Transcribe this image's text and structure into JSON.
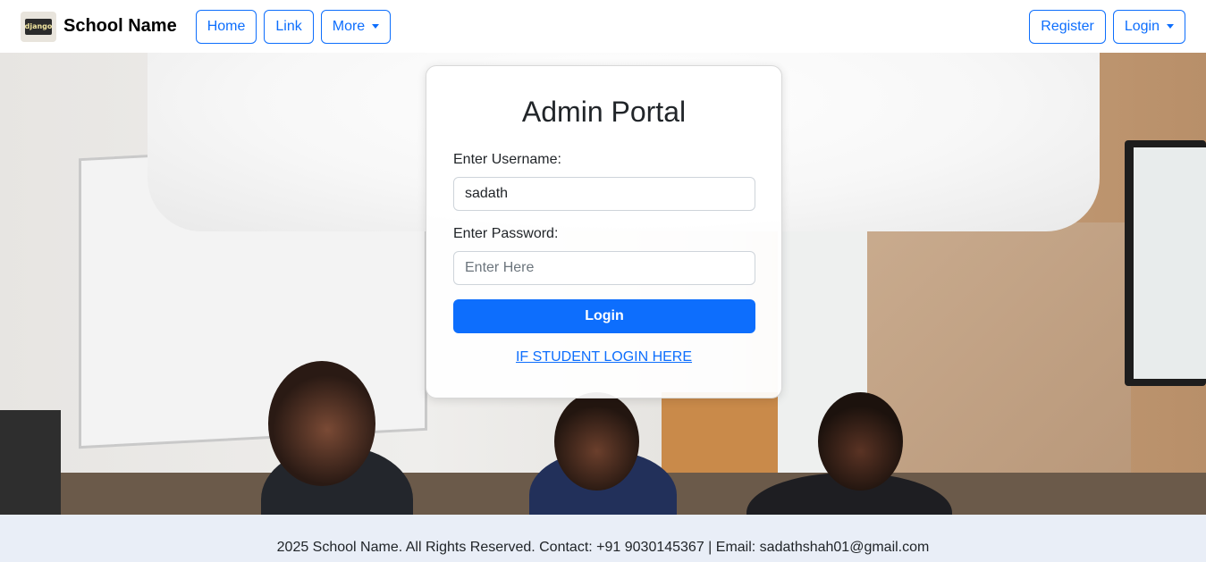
{
  "brand": {
    "name": "School Name",
    "logo_text": "django"
  },
  "nav": {
    "home": "Home",
    "link": "Link",
    "more": "More",
    "register": "Register",
    "login": "Login"
  },
  "login_card": {
    "title": "Admin Portal",
    "username_label": "Enter Username:",
    "username_value": "sadath",
    "password_label": "Enter Password:",
    "password_placeholder": "Enter Here",
    "submit_label": "Login",
    "student_link": "IF STUDENT LOGIN HERE"
  },
  "footer": {
    "text": "2025 School Name. All Rights Reserved. Contact: +91 9030145367 | Email: sadathshah01@gmail.com"
  },
  "colors": {
    "accent": "#0d6efd",
    "footer_bg": "#e9eef7"
  }
}
